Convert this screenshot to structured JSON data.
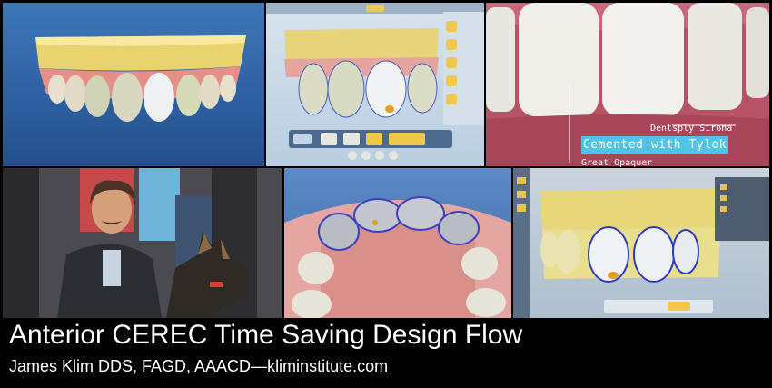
{
  "title": "Anterior CEREC Time Saving Design Flow",
  "author": {
    "prefix": "James Klim DDS, FAGD, AAACD—",
    "link": "kliminstitute.com"
  },
  "clinical_photo": {
    "label_top": "Dentsply Sirona",
    "callout": "Cemented with Tylok",
    "label_bottom": "Great Opaquer"
  },
  "panels": [
    "design-model-frontal",
    "cerec-software-design",
    "clinical-result-photo",
    "presenter-photo",
    "occlusal-design-view",
    "cerec-software-final"
  ],
  "colors": {
    "background": "#000000",
    "software_blue": "#3f77b8",
    "model_gold": "#e8d27a",
    "callout": "#4fc4e8"
  }
}
